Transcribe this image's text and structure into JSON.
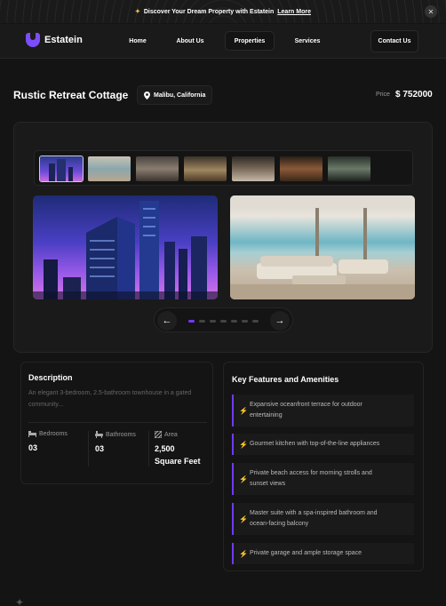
{
  "banner": {
    "text": "Discover Your Dream Property with Estatein",
    "link": "Learn More",
    "icons": {
      "star": "sparkle-icon",
      "close": "close-icon"
    }
  },
  "nav": {
    "logo_text": "Estatein",
    "links": [
      "Home",
      "About Us",
      "Properties",
      "Services"
    ],
    "active": "Properties",
    "contact": "Contact Us"
  },
  "property": {
    "title": "Rustic Retreat Cottage",
    "location": "Malibu, California",
    "price_label": "Price",
    "price": "$ 752000"
  },
  "gallery": {
    "thumbnail_count": 7,
    "selected_index": 0,
    "dots": 7,
    "active_dot": 0,
    "prev_icon": "arrow-left-icon",
    "next_icon": "arrow-right-icon"
  },
  "description": {
    "title": "Description",
    "text": "An elegant 3-bedroom, 2.5-bathroom townhouse in a gated community...",
    "bedrooms_label": "Bedrooms",
    "bedrooms": "03",
    "bathrooms_label": "Bathrooms",
    "bathrooms": "03",
    "area_label": "Area",
    "area_line1": "2,500",
    "area_line2": "Square Feet"
  },
  "features": {
    "title": "Key Features and Amenities",
    "items": [
      {
        "line1": "Expansive oceanfront terrace for outdoor",
        "line2": "entertaining"
      },
      {
        "line1": "Gourmet kitchen with top-of-the-line appliances",
        "line2": ""
      },
      {
        "line1": "Private beach access for morning strolls and",
        "line2": "sunset views"
      },
      {
        "line1": "Master suite with a spa-inspired bathroom and",
        "line2": "ocean-facing balcony"
      },
      {
        "line1": "Private garage and ample storage space",
        "line2": ""
      }
    ]
  },
  "colors": {
    "accent": "#703bf7",
    "background": "#141414",
    "card": "#1a1a1a"
  }
}
